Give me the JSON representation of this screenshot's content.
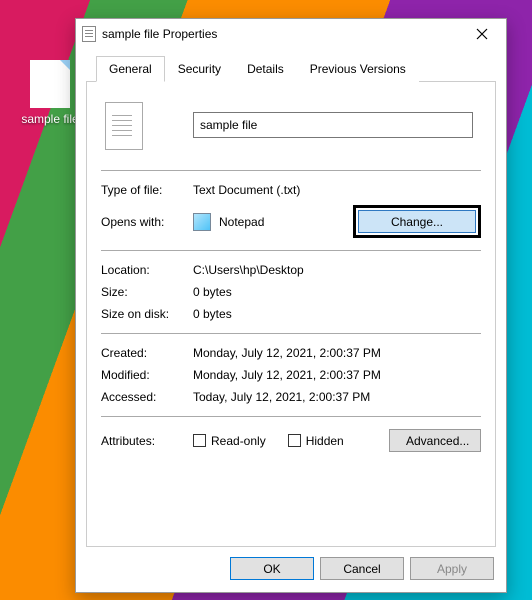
{
  "desktop": {
    "file_label": "sample file"
  },
  "dialog": {
    "title": "sample file Properties",
    "tabs": {
      "general": "General",
      "security": "Security",
      "details": "Details",
      "previous": "Previous Versions"
    },
    "filename": "sample file",
    "labels": {
      "type_of_file": "Type of file:",
      "opens_with": "Opens with:",
      "location": "Location:",
      "size": "Size:",
      "size_on_disk": "Size on disk:",
      "created": "Created:",
      "modified": "Modified:",
      "accessed": "Accessed:",
      "attributes": "Attributes:"
    },
    "values": {
      "type_of_file": "Text Document (.txt)",
      "opens_with": "Notepad",
      "location": "C:\\Users\\hp\\Desktop",
      "size": "0 bytes",
      "size_on_disk": "0 bytes",
      "created": "Monday, July 12, 2021, 2:00:37 PM",
      "modified": "Monday, July 12, 2021, 2:00:37 PM",
      "accessed": "Today, July 12, 2021, 2:00:37 PM"
    },
    "checkboxes": {
      "readonly": "Read-only",
      "hidden": "Hidden"
    },
    "buttons": {
      "change": "Change...",
      "advanced": "Advanced...",
      "ok": "OK",
      "cancel": "Cancel",
      "apply": "Apply"
    }
  }
}
